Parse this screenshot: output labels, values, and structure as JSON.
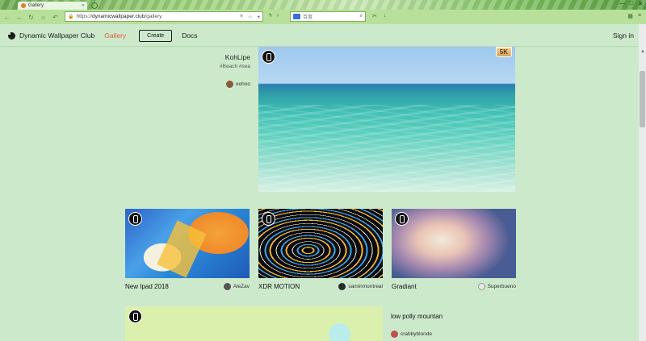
{
  "browser": {
    "tab_title": "Gallery",
    "url_scheme": "https://",
    "url_host": "dynamicwallpaper.club",
    "url_path": "/gallery",
    "search_placeholder": "百度",
    "window_controls": [
      "—",
      "□",
      "✕"
    ]
  },
  "nav": {
    "brand": "Dynamic Wallpaper Club",
    "gallery": "Gallery",
    "create": "Create",
    "docs": "Docs",
    "signin": "Sign in"
  },
  "featured": {
    "title": "KohLipe",
    "tags": "#Beach #sea",
    "author": "oohoo",
    "resolution": "5K"
  },
  "cards": [
    {
      "title": "New Ipad 2018",
      "author": "AleZav"
    },
    {
      "title": "XDR MOTION",
      "author": "saminmontreal"
    },
    {
      "title": "Gradiant",
      "author": "Superbueno"
    }
  ],
  "bottom": {
    "title": "low polly mountan",
    "author": "crabbyblonde"
  },
  "colors": {
    "page_bg": "#cce9cc",
    "accent_gallery": "#e8593b",
    "chrome_green": "#b8e09a"
  }
}
